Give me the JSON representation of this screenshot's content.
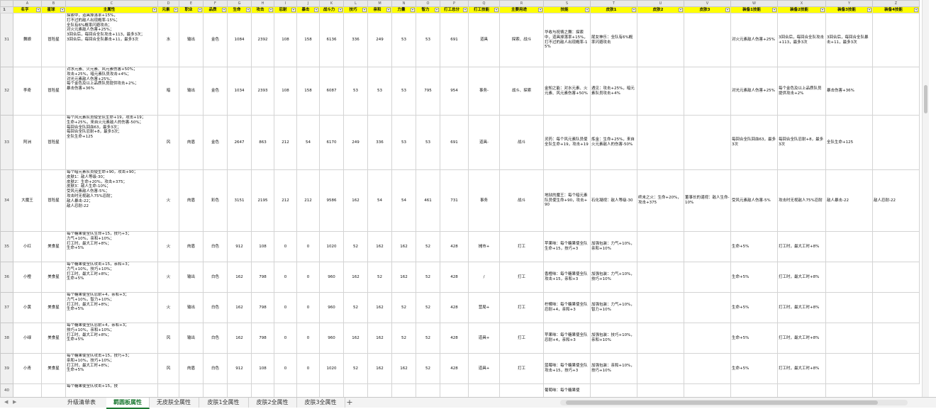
{
  "column_letters": [
    "A",
    "B",
    "C",
    "D",
    "E",
    "F",
    "G",
    "H",
    "I",
    "J",
    "K",
    "L",
    "M",
    "N",
    "O",
    "P",
    "Q",
    "R",
    "S",
    "T",
    "U",
    "V",
    "W",
    "X",
    "Y",
    "Z"
  ],
  "header_row_number": "1",
  "headers": [
    "名字",
    "星球",
    "主属性",
    "元素",
    "职业",
    "品质",
    "生命",
    "攻击",
    "忍耐",
    "暴击",
    "战斗力",
    "技巧",
    "亲和",
    "力量",
    "智力",
    "打工总分",
    "打工技能",
    "主要用途",
    "技能",
    "皮肤1",
    "皮肤2",
    "皮肤3",
    "装备1技能",
    "装备2技能",
    "装备3技能",
    "装备4技能"
  ],
  "rows": [
    {
      "num": "31",
      "cells": [
        "舞娘",
        "冒险星",
        "探索中，道具掉落率+15%，\n打不过的敌人出现概率-15%；\n全队有6%概率闪避攻击；\n对火元素敌人伤害+25%；\n3回合后，每回合全队攻击+113，最多3次；\n3回合后，每回合全队暴击+11，最多3次",
        "水",
        "输出",
        "金色",
        "1084",
        "2392",
        "108",
        "158",
        "6136",
        "336",
        "249",
        "53",
        "53",
        "691",
        "道具",
        "探索、战斗",
        "华收与祝祷之舞：探索中，道具掉落率+15%，打不过的敌人出现概率-15%",
        "尾女神乐：全队有6%概率闪避攻击",
        "",
        "",
        "对火元素敌人伤害+25%",
        "3回合后，每回合全队攻击+113，最多3次",
        "3回合后，每回合全队暴击+11，最多3次",
        ""
      ]
    },
    {
      "num": "32",
      "cells": [
        "李奇",
        "冒险星",
        "对水元素、火元素、风元素伤害+50%；\n攻击+25%，暗元素队员攻击+4%；\n对光元素敌人伤害+25%；\n每个金色及以上品质队员提供攻击+2%；\n暴击伤害+36%",
        "暗",
        "输出",
        "金色",
        "1034",
        "2393",
        "108",
        "158",
        "6087",
        "53",
        "53",
        "53",
        "795",
        "954",
        "事务-",
        "战斗、探索",
        "金知之能：对水元素、火元素、风元素伤害+50%",
        "遇见：攻击+25%，暗元素队员攻击+4%",
        "",
        "",
        "对光元素敌人伤害+25%",
        "每个金色及以上品质队员提供攻击+2%",
        "暴击伤害+36%",
        ""
      ]
    },
    {
      "num": "33",
      "cells": [
        "阿洲",
        "冒险星",
        "每个风元素队员使全队生命+19，攻击+19；\n生命+25%，来自火元素敌人的伤害-50%；\n每回合全队回血63，最多3次；\n每回合全队忍耐+8，最多3次；\n全队生命+125",
        "风",
        "肉盾",
        "金色",
        "2647",
        "863",
        "212",
        "54",
        "6170",
        "249",
        "336",
        "53",
        "53",
        "691",
        "道具-",
        "战斗",
        "灵药：每个风元素队员使全队生命+19，攻击+19",
        "炼金：生命+25%，来自火元素敌人的伤害-50%",
        "",
        "",
        "每回合全队回血63，最多3次",
        "每回合全队忍耐+8，最多3次",
        "全队生命+125",
        ""
      ]
    },
    {
      "num": "34",
      "cells": [
        "大魔王",
        "冒险星",
        "每个暗元素队员使生命+90，攻击+90；\n皮肤1：敌人等级-30；\n皮肤2：生命+20%，攻击+375；\n皮肤3：敌人生命-10%；\n受风元素敌人伤害-5%；\n攻击时无视敌人75%忍耐；\n敌人暴击-22；\n敌人忍耐-22",
        "火",
        "肉盾",
        "彩色",
        "3151",
        "2195",
        "212",
        "212",
        "9586",
        "162",
        "54",
        "54",
        "461",
        "731",
        "事务",
        "战斗",
        "地狱的魔王：每个暗元素队员使生命+90，攻击+90",
        "石化凝视：敌人等级-30",
        "终末之火：生命+20%，攻击+375",
        "董事长的谴视：敌人生命-10%",
        "受风元素敌人伤害-5%",
        "攻击时无视敌人75%忍耐",
        "敌人暴击-22",
        "敌人忍耐-22"
      ]
    },
    {
      "num": "35",
      "cells": [
        "小红",
        "美食星",
        "每个糖果使全队生命+15，技巧+3；\n力气+10%，亲和+10%；\n打工时，最大工时+8%；\n生命+5%",
        "火",
        "肉盾",
        "白色",
        "912",
        "108",
        "0",
        "0",
        "1020",
        "52",
        "162",
        "162",
        "52",
        "428",
        "摊市+",
        "打工",
        "苹果味：每个糖果使全队生命+15，技巧+3",
        "加强包装：力气+10%，亲和+10%",
        "",
        "",
        "生命+5%",
        "打工时，最大工时+8%",
        "",
        ""
      ]
    },
    {
      "num": "36",
      "cells": [
        "小橙",
        "美食星",
        "每个糖果使全队攻击+15，亲和+3；\n力气+10%，技巧+10%；\n打工时，最大工时+8%；\n生命+5%",
        "火",
        "输出",
        "白色",
        "162",
        "798",
        "0",
        "0",
        "960",
        "162",
        "52",
        "162",
        "52",
        "428",
        "/",
        "打工",
        "香橙味：每个糖果使全队攻击+15，亲和+3",
        "加强包装：力气+10%，技巧+10%",
        "",
        "",
        "生命+5%",
        "打工时，最大工时+8%",
        "",
        ""
      ]
    },
    {
      "num": "37",
      "cells": [
        "小黄",
        "美食星",
        "每个糖果使全队忍耐+4，亲和+3；\n力气+10%，智力+10%；\n打工时，最大工时+8%；\n生命+5%",
        "火",
        "输出",
        "白色",
        "162",
        "798",
        "0",
        "0",
        "960",
        "52",
        "162",
        "52",
        "52",
        "428",
        "营局+",
        "打工",
        "柠檬味：每个糖果使全队忍耐+4，亲和+3",
        "加强包装：力气+10%，智力+10%",
        "",
        "",
        "生命+5%",
        "打工时，最大工时+8%",
        "",
        ""
      ]
    },
    {
      "num": "38",
      "cells": [
        "小绿",
        "美食星",
        "每个糖果使全队忍耐+4，亲和+3；\n技巧+10%，亲和+10%；\n打工时，最大工时+8%；\n生命+5%",
        "风",
        "输出",
        "白色",
        "162",
        "798",
        "0",
        "0",
        "960",
        "162",
        "162",
        "52",
        "52",
        "428",
        "道具+",
        "打工",
        "苹果味：每个糖果使全队忍耐+4，亲和+3",
        "加强包装：技巧+10%，亲和+10%",
        "",
        "",
        "生命+5%",
        "打工时，最大工时+8%",
        "",
        ""
      ]
    },
    {
      "num": "39",
      "cells": [
        "小青",
        "美食星",
        "每个糖果使全队攻击+15，技巧+3；\n亲和+10%，技巧+10%；\n打工时，最大工时+8%；\n生命+5%",
        "风",
        "肉盾",
        "白色",
        "912",
        "108",
        "0",
        "0",
        "1020",
        "52",
        "162",
        "162",
        "52",
        "428",
        "道具+",
        "打工",
        "蓝莓味：每个糖果使全队攻击+15，技巧+3",
        "加强包装：亲和+10%，技巧+10%",
        "",
        "",
        "生命+5%",
        "打工时，最大工时+8%",
        "",
        ""
      ]
    },
    {
      "num": "40",
      "cells": [
        "",
        "",
        "每个糖果使全队攻击+15，技",
        "",
        "",
        "",
        "",
        "",
        "",
        "",
        "",
        "",
        "",
        "",
        "",
        "",
        "",
        "",
        "葡萄味：每个糖果使",
        "",
        "",
        "",
        "",
        "",
        ""
      ]
    }
  ],
  "sheet_tabs": [
    "升级清单表",
    "羁圆板属性",
    "无皮肤全属性",
    "皮肤1全属性",
    "皮肤2全属性",
    "皮肤3全属性"
  ],
  "active_tab": "羁圆板属性",
  "add_sheet_label": "+",
  "nav_left_label": "◀",
  "nav_right_label": "▶",
  "colors": {
    "header_fill": "#ffff00",
    "active_tab": "#1e7a34"
  }
}
